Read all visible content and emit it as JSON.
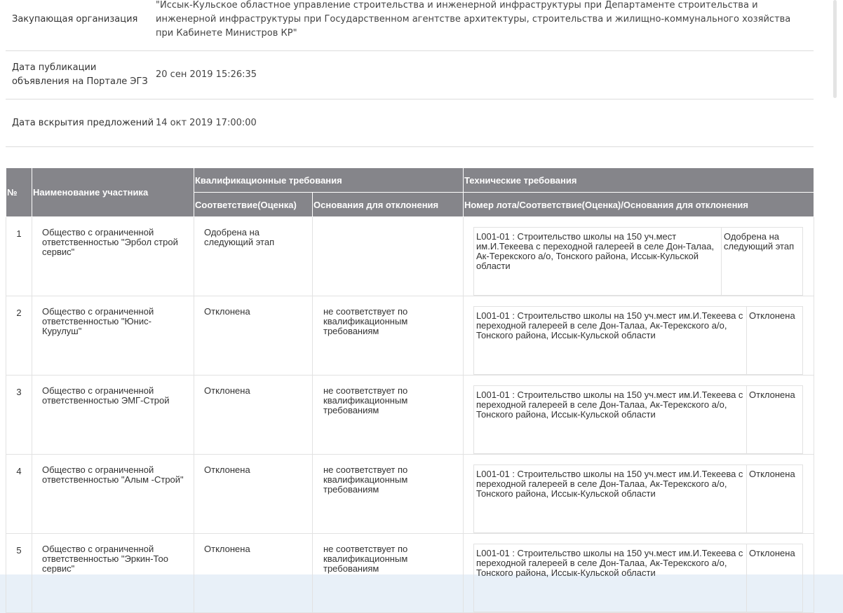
{
  "info": {
    "rows": [
      {
        "label": "Закупающая организация",
        "value": "\"Иссык-Кульское областное управление строительства и инженерной инфраструктуры при Департаменте строительства и инженерной инфраструктуры при Государственном агентстве архитектуры, строительства и жилищно-коммунального хозяйства при Кабинете Министров КР\""
      },
      {
        "label": "Дата публикации объявления на Портале ЭГЗ",
        "value": "20 сен 2019 15:26:35"
      },
      {
        "label": "Дата вскрытия предложений",
        "value": "14 окт 2019 17:00:00"
      }
    ]
  },
  "table": {
    "headers": {
      "num": "№",
      "name": "Наименование участника",
      "qualification": "Квалификационные требования",
      "technical": "Технические требования",
      "compliance": "Соответствие(Оценка)",
      "rejection_reason": "Основания для отклонения",
      "lot_header": "Номер лота/Соответствие(Оценка)/Основания для отклонения"
    },
    "rows": [
      {
        "num": "1",
        "name": "Общество с ограниченной ответственностью \"Эрбол строй сервис\"",
        "compliance": "Одобрена на следующий этап",
        "reason": "",
        "lot": "L001-01 : Строительство школы на 150 уч.мест им.И.Текеева с переходной галереей в селе Дон-Талаа, Ак-Терекского а/о, Тонского района, Иссык-Кульской области",
        "lot_status": "Одобрена на следующий этап"
      },
      {
        "num": "2",
        "name": "Общество с ограниченной ответственностью \"Юнис-Курулуш\"",
        "compliance": "Отклонена",
        "reason": "не соответствует по квалификационным требованиям",
        "lot": "L001-01 : Строительство школы на 150 уч.мест им.И.Текеева с переходной галереей в селе Дон-Талаа, Ак-Терекского а/о, Тонского района, Иссык-Кульской области",
        "lot_status": "Отклонена"
      },
      {
        "num": "3",
        "name": "Общество с ограниченной ответственностью ЭМГ-Строй",
        "compliance": "Отклонена",
        "reason": "не соответствует по квалификационным требованиям",
        "lot": "L001-01 : Строительство школы на 150 уч.мест им.И.Текеева с переходной галереей в селе Дон-Талаа, Ак-Терекского а/о, Тонского района, Иссык-Кульской области",
        "lot_status": "Отклонена"
      },
      {
        "num": "4",
        "name": "Общество с ограниченной ответственностью \"Алым -Строй\"",
        "compliance": "Отклонена",
        "reason": "не соответствует по квалификационным требованиям",
        "lot": "L001-01 : Строительство школы на 150 уч.мест им.И.Текеева с переходной галереей в селе Дон-Талаа, Ак-Терекского а/о, Тонского района, Иссык-Кульской области",
        "lot_status": "Отклонена"
      },
      {
        "num": "5",
        "name": "Общество с ограниченной ответственностью \"Эркин-Тоо сервис\"",
        "compliance": "Отклонена",
        "reason": "не соответствует по квалификационным требованиям",
        "lot": "L001-01 : Строительство школы на 150 уч.мест им.И.Текеева с переходной галереей в селе Дон-Талаа, Ак-Терекского а/о, Тонского района, Иссык-Кульской области",
        "lot_status": "Отклонена"
      }
    ]
  }
}
